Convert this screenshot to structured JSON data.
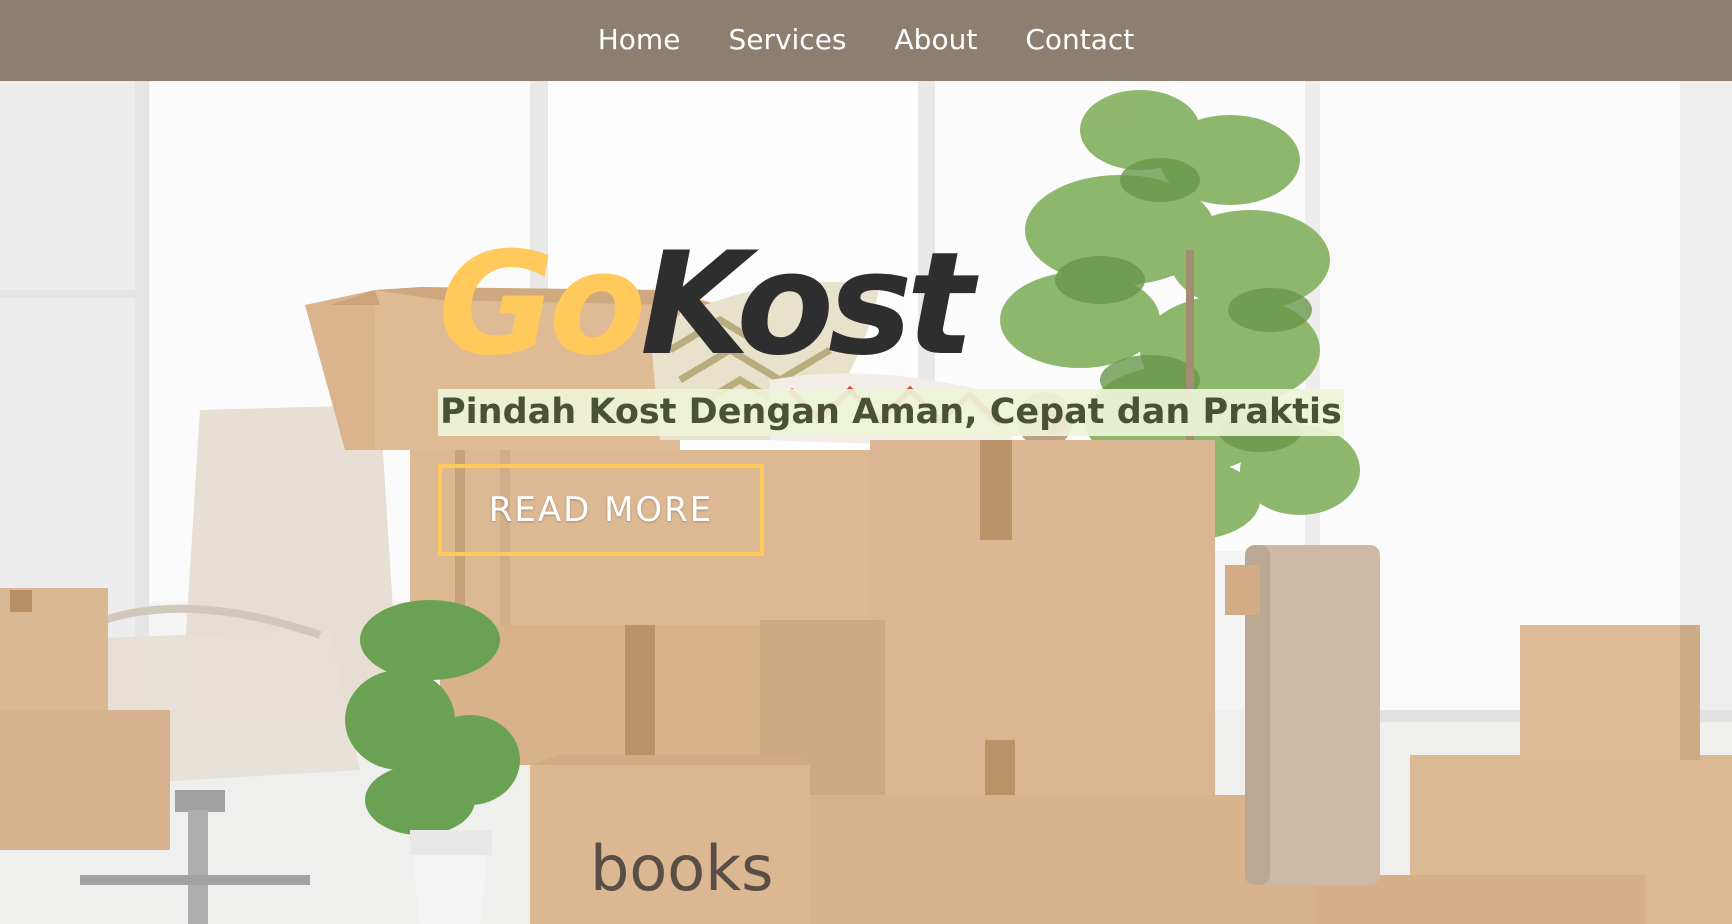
{
  "navbar": {
    "items": [
      {
        "label": "Home"
      },
      {
        "label": "Services"
      },
      {
        "label": "About"
      },
      {
        "label": "Contact"
      }
    ],
    "background": "#8c7f70"
  },
  "hero": {
    "brand_part1": "Go",
    "brand_part2": "Kost",
    "brand_colors": {
      "part1": "#ffc95c",
      "part2": "#2e2e2e"
    },
    "tagline": "Pindah Kost Dengan Aman, Cepat dan Praktis",
    "cta_label": "READ MORE",
    "cta_border_color": "#ffc95c",
    "background_image": {
      "box_label": "books"
    }
  }
}
